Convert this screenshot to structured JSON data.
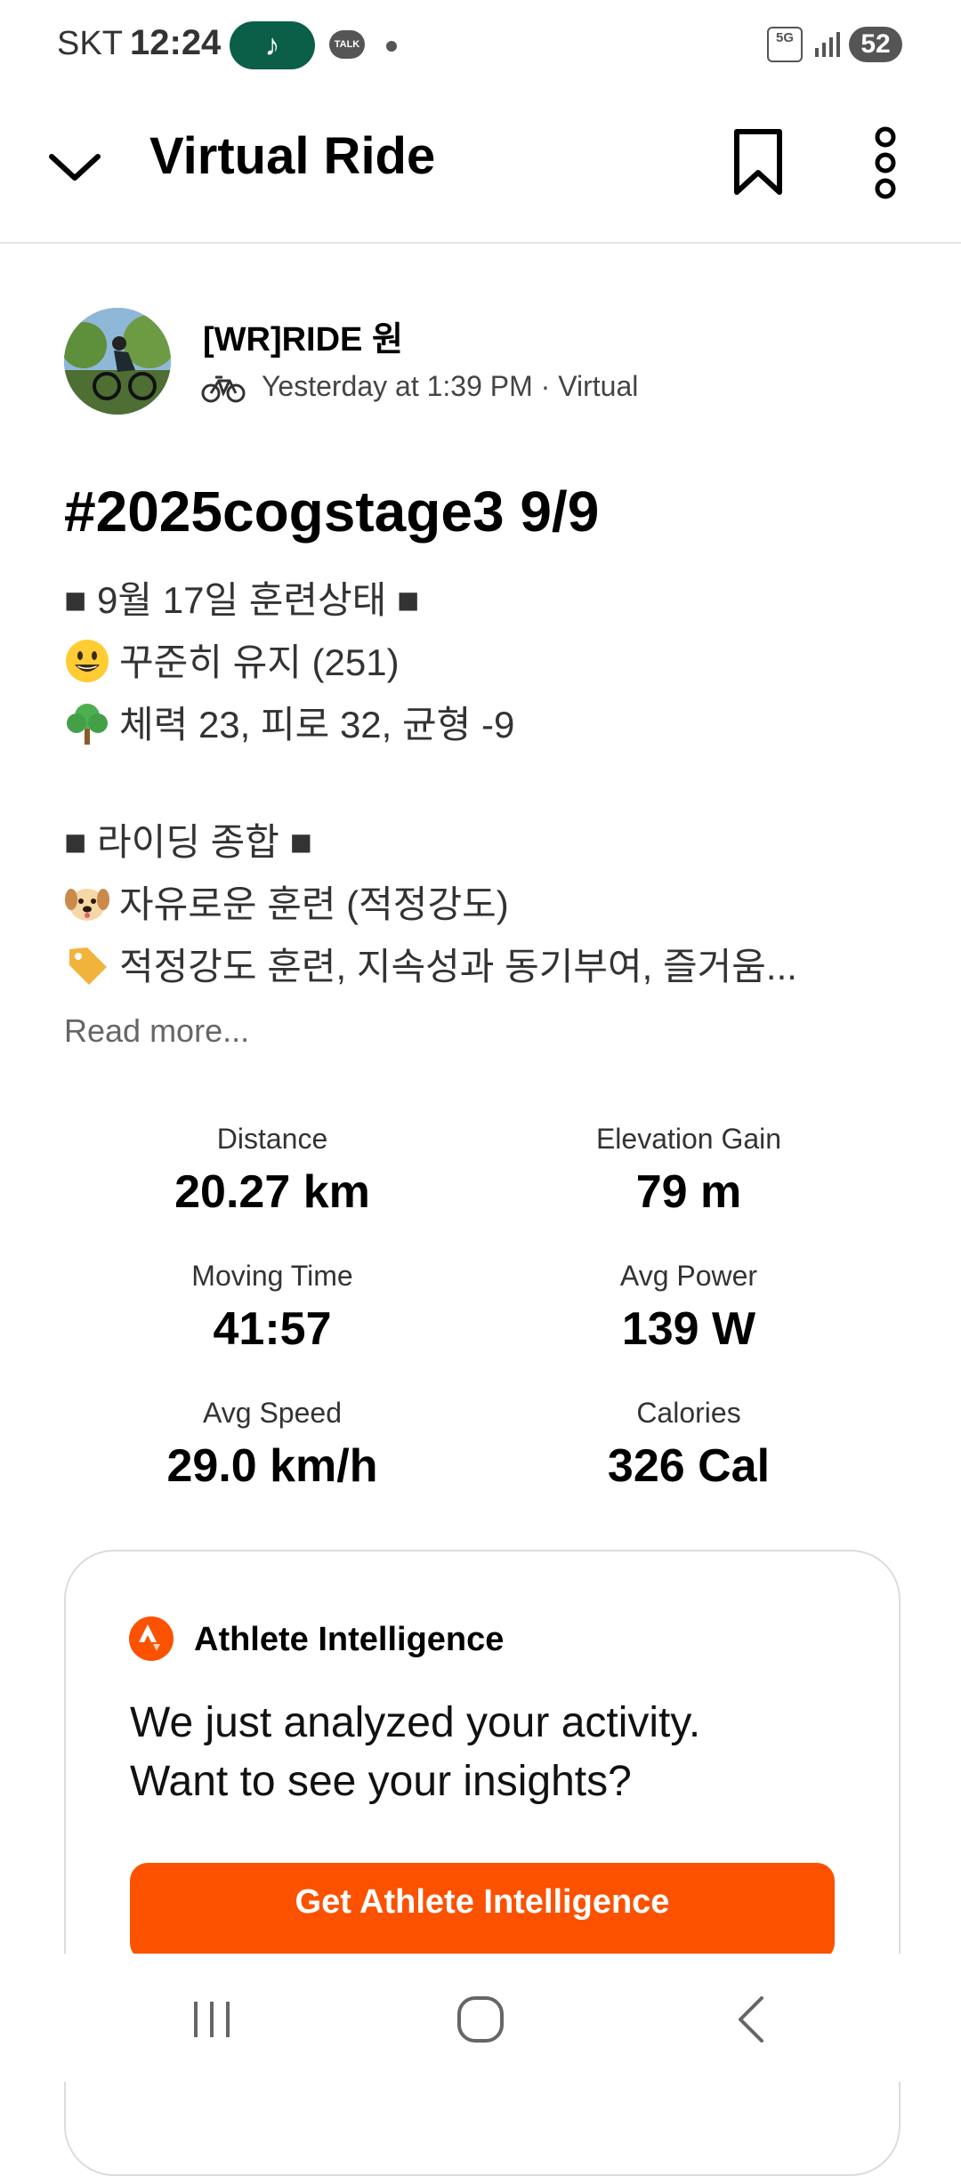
{
  "status_bar": {
    "carrier": "SKT",
    "time": "12:24",
    "music_icon": "♪",
    "talk_badge": "TALK",
    "network": "5G",
    "battery": "52"
  },
  "header": {
    "title": "Virtual Ride"
  },
  "athlete": {
    "name": "[WR]RIDE 원",
    "meta": "Yesterday at 1:39 PM · Virtual"
  },
  "activity": {
    "title": "#2025cogstage3 9/9",
    "description": [
      {
        "emoji": "",
        "text": "■ 9월 17일 훈련상태 ■"
      },
      {
        "emoji": "smiley-emoji",
        "text": "꾸준히 유지 (251)"
      },
      {
        "emoji": "tree-emoji",
        "text": "체력 23, 피로 32, 균형 -9"
      },
      {
        "emoji": "",
        "text": ""
      },
      {
        "emoji": "",
        "text": "■ 라이딩 종합 ■"
      },
      {
        "emoji": "dog-emoji",
        "text": "자유로운 훈련 (적정강도)"
      },
      {
        "emoji": "tag-emoji",
        "text": "적정강도 훈련, 지속성과 동기부여, 즐거움..."
      }
    ],
    "read_more": "Read more..."
  },
  "stats": [
    {
      "label": "Distance",
      "value": "20.27 km"
    },
    {
      "label": "Elevation Gain",
      "value": "79 m"
    },
    {
      "label": "Moving Time",
      "value": "41:57"
    },
    {
      "label": "Avg Power",
      "value": "139 W"
    },
    {
      "label": "Avg Speed",
      "value": "29.0 km/h"
    },
    {
      "label": "Calories",
      "value": "326 Cal"
    }
  ],
  "ai_card": {
    "title": "Athlete Intelligence",
    "text_line1": "We just analyzed your activity.",
    "text_line2": "Want to see your insights?",
    "button": "Get Athlete Intelligence"
  },
  "colors": {
    "accent": "#fc5200",
    "music_pill": "#0b5e47"
  }
}
